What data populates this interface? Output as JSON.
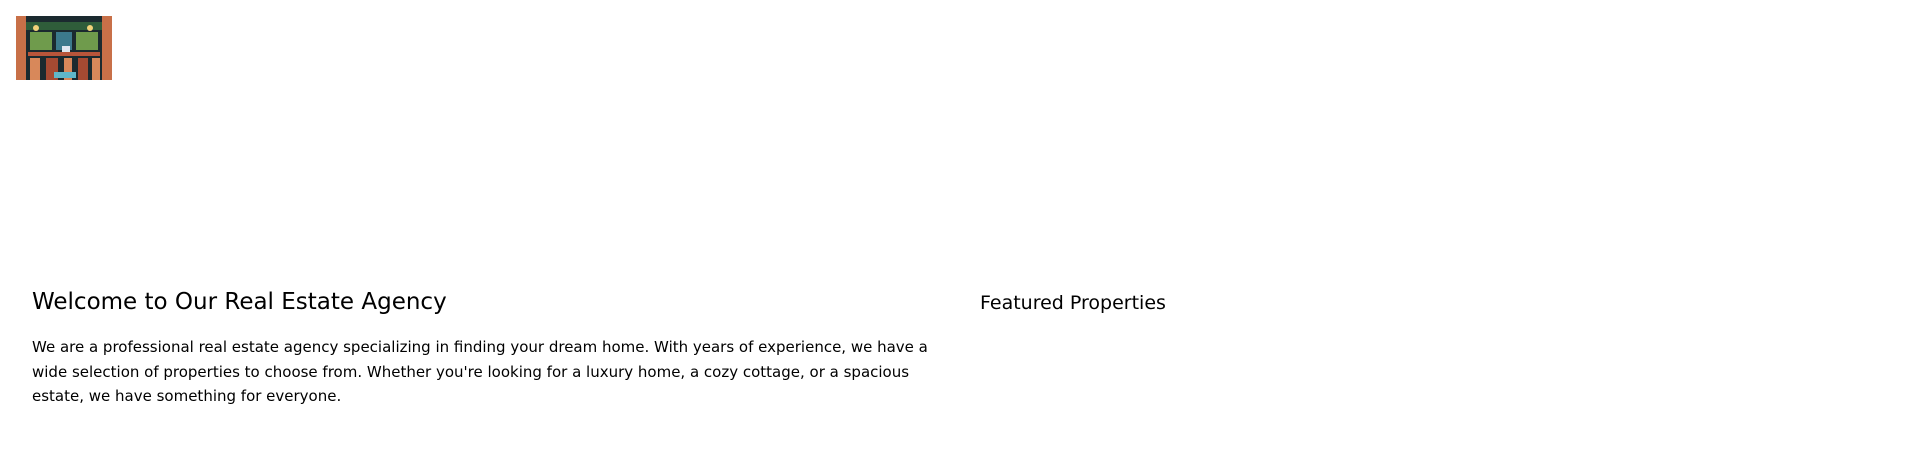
{
  "header": {
    "logo_icon": "building-facade-logo"
  },
  "intro": {
    "title": "Welcome to Our Real Estate Agency",
    "body": "We are a professional real estate agency specializing in finding your dream home. With years of experience, we have a wide selection of properties to choose from. Whether you're looking for a luxury home, a cozy cottage, or a spacious estate, we have something for everyone."
  },
  "featured": {
    "title": "Featured Properties"
  },
  "colors": {
    "background": "#ffffff",
    "text": "#000000"
  }
}
